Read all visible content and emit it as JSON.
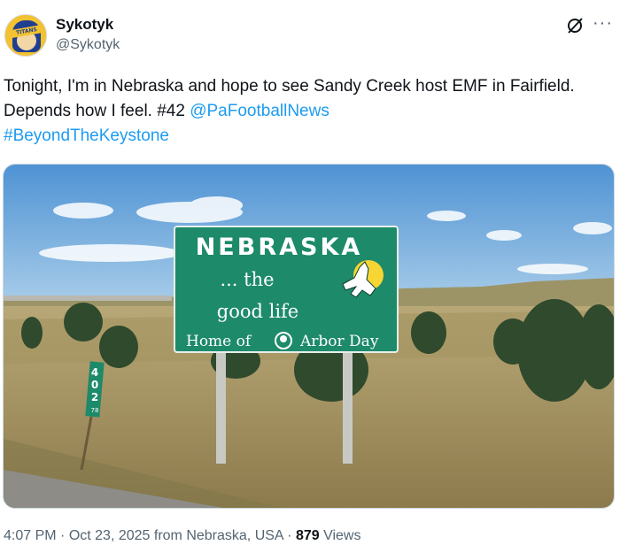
{
  "author": {
    "display_name": "Sykotyk",
    "handle": "@Sykotyk",
    "avatar_text": "TITANS"
  },
  "actions": {
    "grok_icon": "grok-slash-icon",
    "more_icon": "more-horizontal-icon"
  },
  "tweet": {
    "text_before": "Tonight, I'm in Nebraska and hope to see Sandy Creek host EMF in Fairfield. Depends how I feel. #42 ",
    "mention": "@PaFootballNews",
    "hashtag": "#BeyondTheKeystone"
  },
  "photo": {
    "sign_title": "NEBRASKA",
    "sign_line1": "... the",
    "sign_line2": "good life",
    "sign_footer_left": "Home of",
    "sign_footer_right": "Arbor Day",
    "milepost_digits": [
      "4",
      "0",
      "2"
    ],
    "milepost_small": "78"
  },
  "meta": {
    "time": "4:07 PM",
    "sep1": " · ",
    "date": "Oct 23, 2025",
    "location": " from Nebraska, USA",
    "sep2": " · ",
    "views_count": "879",
    "views_label": " Views"
  },
  "colors": {
    "link": "#1d9bf0",
    "muted": "#536471",
    "sign_green": "#1d8a6a",
    "sky": "#5f9fd8"
  }
}
